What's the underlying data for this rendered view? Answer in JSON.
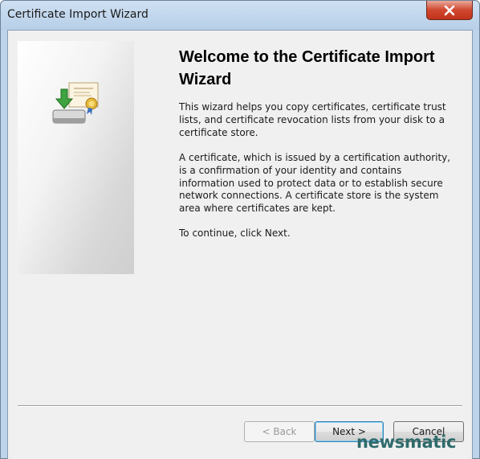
{
  "window": {
    "title": "Certificate Import Wizard"
  },
  "content": {
    "heading": "Welcome to the Certificate Import Wizard",
    "paragraphs": [
      "This wizard helps you copy certificates, certificate trust lists, and certificate revocation lists from your disk to a certificate store.",
      "A certificate, which is issued by a certification authority, is a confirmation of your identity and contains information used to protect data or to establish secure network connections. A certificate store is the system area where certificates are kept.",
      "To continue, click Next."
    ]
  },
  "buttons": {
    "back": "< Back",
    "next": "Next >",
    "cancel": "Cancel"
  },
  "watermark": "newsmatic",
  "colors": {
    "close_button": "#c8402a",
    "dialog_background": "#f0f0f0",
    "title_bar": "#bcd3ea",
    "watermark": "#2f6b6b"
  },
  "icons": [
    "close-icon",
    "certificate-import-icon"
  ]
}
